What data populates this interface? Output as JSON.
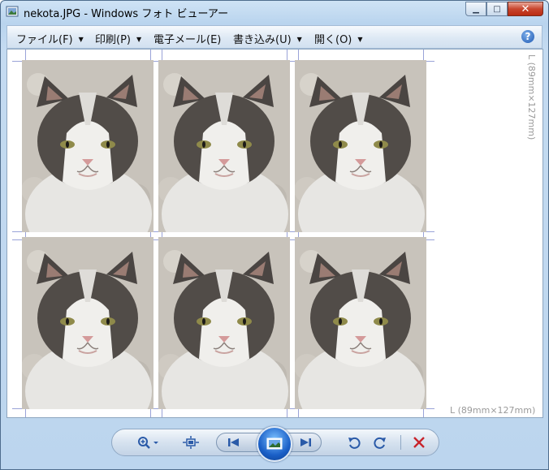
{
  "window": {
    "title": "nekota.JPG - Windows フォト ビューアー",
    "min_label": "▁",
    "max_label": "□",
    "close_label": "✕"
  },
  "menu": {
    "items": [
      {
        "label": "ファイル(F)",
        "has_dropdown": true
      },
      {
        "label": "印刷(P)",
        "has_dropdown": true
      },
      {
        "label": "電子メール(E)",
        "has_dropdown": false
      },
      {
        "label": "書き込み(U)",
        "has_dropdown": true
      },
      {
        "label": "開く(O)",
        "has_dropdown": true
      }
    ],
    "help_label": "?"
  },
  "content": {
    "paper_size_label": "L (89mm×127mm)",
    "photo_count": 6
  },
  "toolbar": {
    "icons": [
      "zoom-icon",
      "fit-to-window-icon",
      "previous-icon",
      "slideshow-icon",
      "next-icon",
      "rotate-ccw-icon",
      "rotate-cw-icon",
      "delete-icon"
    ]
  },
  "colors": {
    "accent": "#2a5aa8",
    "delete": "#c8242b",
    "guide": "#9aa3d8"
  }
}
